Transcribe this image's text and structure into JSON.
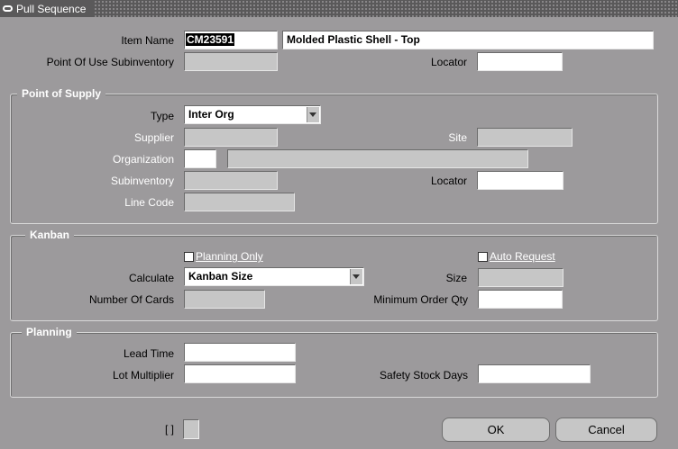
{
  "window": {
    "title": "Pull Sequence"
  },
  "header": {
    "item_name_label": "Item Name",
    "item_name_value": "CM23591",
    "item_description": "Molded Plastic Shell - Top",
    "pou_subinventory_label": "Point Of Use Subinventory",
    "pou_subinventory_value": "",
    "locator_label": "Locator",
    "locator_value": ""
  },
  "supply": {
    "group_title": "Point of Supply",
    "type_label": "Type",
    "type_value": "Inter Org",
    "supplier_label": "Supplier",
    "site_label": "Site",
    "organization_label": "Organization",
    "subinventory_label": "Subinventory",
    "locator_label": "Locator",
    "line_code_label": "Line Code"
  },
  "kanban": {
    "group_title": "Kanban",
    "planning_only_label": "Planning Only",
    "auto_request_label": "Auto Request",
    "calculate_label": "Calculate",
    "calculate_value": "Kanban Size",
    "size_label": "Size",
    "num_cards_label": "Number Of Cards",
    "min_order_label": "Minimum Order Qty"
  },
  "planning": {
    "group_title": "Planning",
    "lead_time_label": "Lead Time",
    "lot_multiplier_label": "Lot Multiplier",
    "safety_stock_label": "Safety Stock Days"
  },
  "footer": {
    "brackets_label": "[ ]",
    "ok_label": "OK",
    "cancel_label": "Cancel"
  }
}
